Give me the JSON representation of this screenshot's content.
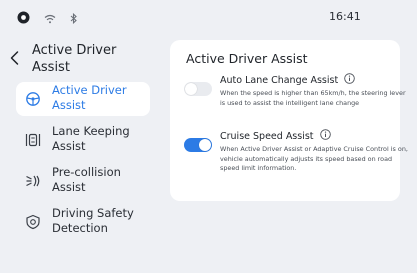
{
  "status_bar": {
    "time": "16:41",
    "icons": [
      "record-icon",
      "wifi-icon",
      "bluetooth-icon"
    ]
  },
  "nav": {
    "title": "Active Driver Assist",
    "items": [
      {
        "label": "Active Driver Assist",
        "icon": "steering-wheel-icon",
        "active": true
      },
      {
        "label": "Lane Keeping Assist",
        "icon": "lane-keeping-icon",
        "active": false
      },
      {
        "label": "Pre-collision Assist",
        "icon": "pre-collision-icon",
        "active": false
      },
      {
        "label": "Driving Safety Detection",
        "icon": "safety-detection-icon",
        "active": false
      }
    ]
  },
  "card": {
    "title": "Active Driver Assist",
    "options": [
      {
        "title": "Auto Lane Change Assist",
        "enabled": false,
        "description": "When the speed is higher than 65km/h, the steering lever is used to assist the intelligent lane change"
      },
      {
        "title": "Cruise Speed Assist",
        "enabled": true,
        "description": "When Active Driver Assist or Adaptive Cruise Control is on, vehicle automatically adjusts its speed based on road speed limit information."
      }
    ]
  },
  "colors": {
    "accent": "#2c7be5",
    "background": "#eef0f4",
    "card": "#ffffff",
    "toggle_off": "#e9ebef"
  }
}
